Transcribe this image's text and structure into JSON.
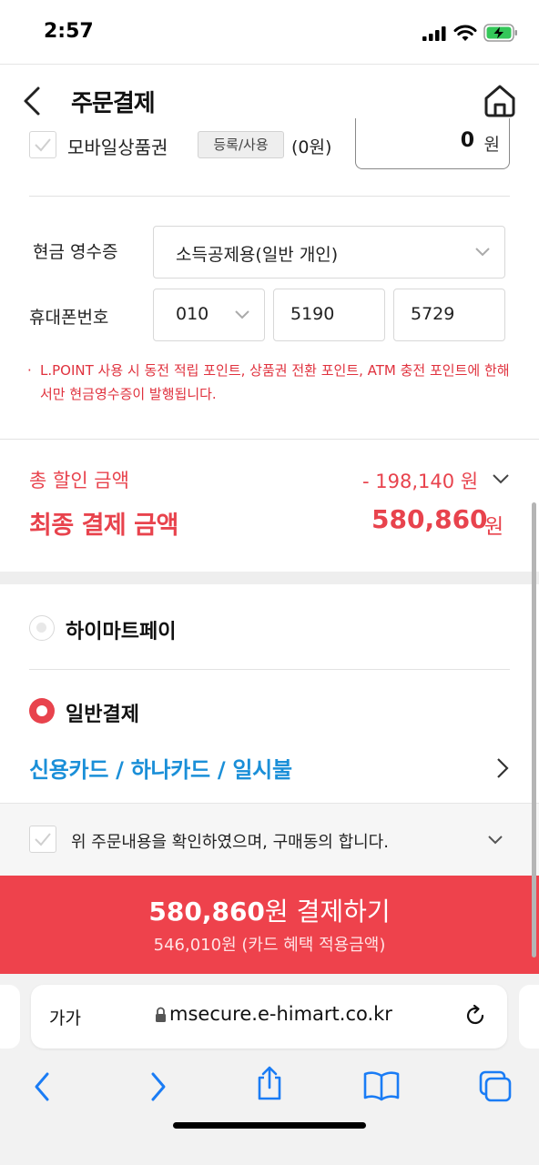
{
  "status": {
    "time": "2:57"
  },
  "header": {
    "title": "주문결제"
  },
  "voucher": {
    "label": "모바일상품권",
    "button": "등록/사용",
    "count": "(0원)",
    "amount": "0",
    "unit": "원"
  },
  "receipt": {
    "label": "현금 영수증",
    "type_selected": "소득공제용(일반 개인)",
    "phone_label": "휴대폰번호",
    "phone": [
      "010",
      "5190",
      "5729"
    ],
    "notice": "L.POINT 사용 시 동전 적립 포인트, 상품권 전환 포인트, ATM 충전 포인트에 한해서만 현금영수증이 발행됩니다."
  },
  "totals": {
    "discount_label": "총 할인 금액",
    "discount_value": "- 198,140 원",
    "final_label": "최종 결제 금액",
    "final_value": "580,860",
    "final_unit": "원"
  },
  "payment": {
    "option1": "하이마트페이",
    "option2": "일반결제",
    "card": "신용카드 / 하나카드 / 일시불"
  },
  "agreement": {
    "text": "위 주문내용을 확인하였으며, 구매동의 합니다."
  },
  "pay_button": {
    "amount": "580,860",
    "label": "원 결제하기",
    "sub": "546,010원 (카드 혜택 적용금액)"
  },
  "browser": {
    "aa": "가가",
    "url": "msecure.e-himart.co.kr"
  },
  "colors": {
    "accent": "#ee424c",
    "link": "#1a8fd8"
  }
}
